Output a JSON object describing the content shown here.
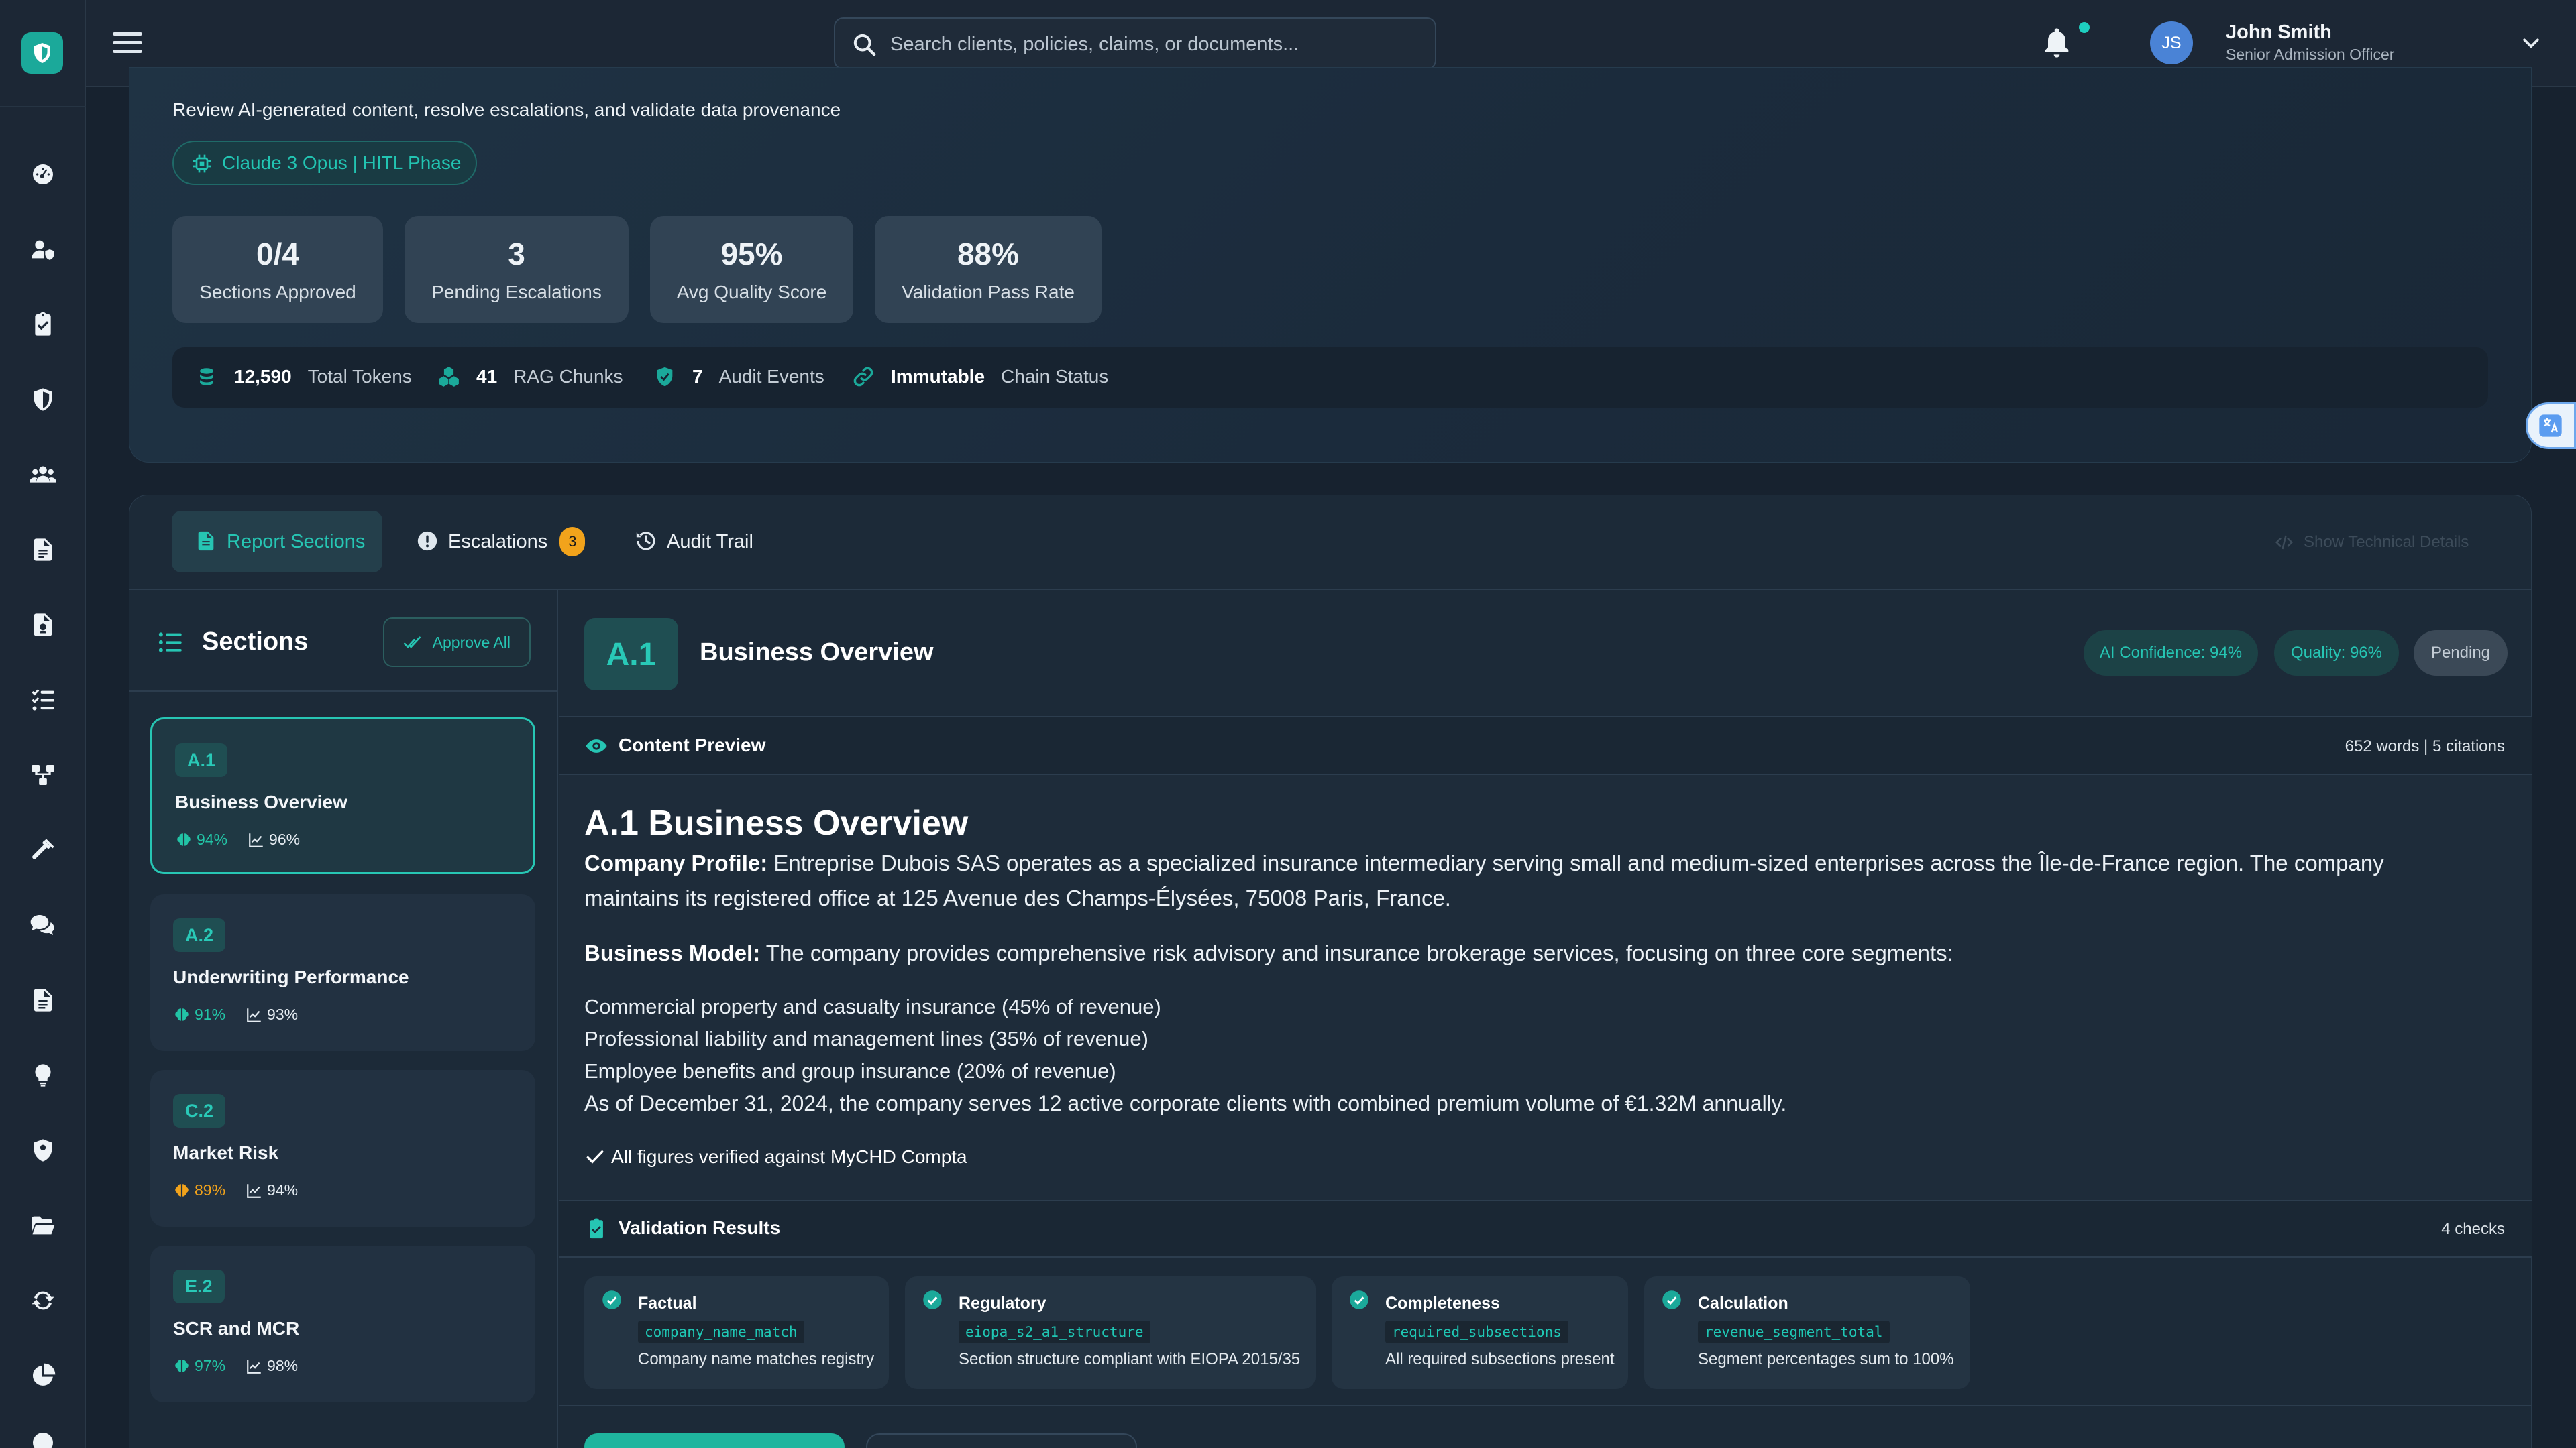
{
  "topbar": {
    "search_placeholder": "Search clients, policies, claims, or documents...",
    "user": {
      "initials": "JS",
      "name": "John Smith",
      "role": "Senior Admission Officer"
    }
  },
  "rail": {
    "icons": [
      "shield-logo-icon",
      "dashboard-gauge-icon",
      "user-shield-icon",
      "clipboard-check-icon",
      "shield-icon",
      "users-icon",
      "file-contract-icon",
      "file-signature-icon",
      "list-check-icon",
      "sitemap-icon",
      "hammer-icon",
      "comments-icon",
      "file-alt-icon",
      "lightbulb-icon",
      "user-shield-badge-icon",
      "folder-open-icon",
      "sync-icon",
      "pie-chart-icon"
    ]
  },
  "hero": {
    "subtitle": "Review AI-generated content, resolve escalations, and validate data provenance",
    "model_badge": "Claude 3 Opus | HITL Phase",
    "stats": [
      {
        "value": "0/4",
        "label": "Sections Approved"
      },
      {
        "value": "3",
        "label": "Pending Escalations"
      },
      {
        "value": "95%",
        "label": "Avg Quality Score"
      },
      {
        "value": "88%",
        "label": "Validation Pass Rate"
      }
    ],
    "metrics": [
      {
        "value": "12,590",
        "label": "Total Tokens"
      },
      {
        "value": "41",
        "label": "RAG Chunks"
      },
      {
        "value": "7",
        "label": "Audit Events"
      },
      {
        "value": "Immutable",
        "label": "Chain Status"
      }
    ]
  },
  "tabs": {
    "report_sections": "Report Sections",
    "escalations": "Escalations",
    "escalations_count": "3",
    "audit_trail": "Audit Trail",
    "show_technical": "Show Technical Details"
  },
  "sections_panel": {
    "title": "Sections",
    "approve_all": "Approve All",
    "items": [
      {
        "code": "A.1",
        "name": "Business Overview",
        "confidence": "94%",
        "quality": "96%"
      },
      {
        "code": "A.2",
        "name": "Underwriting Performance",
        "confidence": "91%",
        "quality": "93%"
      },
      {
        "code": "C.2",
        "name": "Market Risk",
        "confidence": "89%",
        "quality": "94%"
      },
      {
        "code": "E.2",
        "name": "SCR and MCR",
        "confidence": "97%",
        "quality": "98%"
      }
    ]
  },
  "content": {
    "code": "A.1",
    "title": "Business Overview",
    "ai_confidence": "AI Confidence: 94%",
    "quality": "Quality: 96%",
    "status": "Pending",
    "preview_title": "Content Preview",
    "preview_meta": "652 words | 5 citations",
    "doc_heading": "A.1 Business Overview",
    "profile_label": "Company Profile:",
    "profile_text": " Entreprise Dubois SAS operates as a specialized insurance intermediary serving small and medium-sized enterprises across the Île-de-France region. The company maintains its registered office at 125 Avenue des Champs-Élysées, 75008 Paris, France.",
    "model_label": "Business Model:",
    "model_text": " The company provides comprehensive risk advisory and insurance brokerage services, focusing on three core segments:",
    "segments": [
      "Commercial property and casualty insurance (45% of revenue)",
      "Professional liability and management lines (35% of revenue)",
      "Employee benefits and group insurance (20% of revenue)"
    ],
    "summary": "As of December 31, 2024, the company serves 12 active corporate clients with combined premium volume of €1.32M annually.",
    "verified": "All figures verified against MyCHD Compta",
    "validation_title": "Validation Results",
    "validation_meta": "4 checks",
    "checks": [
      {
        "type": "Factual",
        "code": "company_name_match",
        "desc": "Company name matches registry"
      },
      {
        "type": "Regulatory",
        "code": "eiopa_s2_a1_structure",
        "desc": "Section structure compliant with EIOPA 2015/35"
      },
      {
        "type": "Completeness",
        "code": "required_subsections",
        "desc": "All required subsections present"
      },
      {
        "type": "Calculation",
        "code": "revenue_segment_total",
        "desc": "Segment percentages sum to 100%"
      }
    ]
  },
  "colors": {
    "accent": "#1ba99a",
    "teal_text": "#26c5b3",
    "warning": "#f2a31b",
    "background": "#17222f"
  }
}
